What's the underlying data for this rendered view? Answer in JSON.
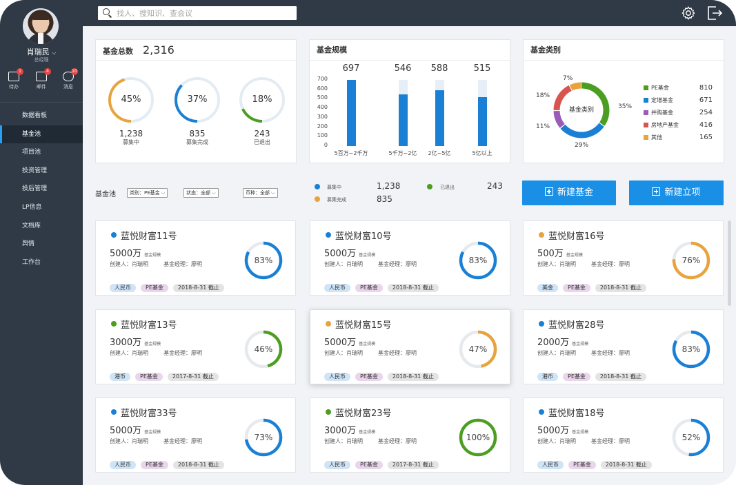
{
  "user": {
    "name": "肖瑞民",
    "role": "总经理"
  },
  "quick": [
    {
      "label": "待办",
      "badge": "1",
      "icon": "todo-icon"
    },
    {
      "label": "邮件",
      "badge": "4",
      "icon": "mail-icon"
    },
    {
      "label": "消息",
      "badge": "10",
      "icon": "message-icon"
    }
  ],
  "nav": [
    "数据看板",
    "基金池",
    "项目池",
    "投资管理",
    "投后管理",
    "LP信息",
    "文档库",
    "舆情",
    "工作台"
  ],
  "nav_active": "基金池",
  "search": {
    "placeholder": "找人、搜知识、查会议"
  },
  "summary": {
    "title": "基金总数",
    "total": "2,316",
    "rings": [
      {
        "pct": "45%",
        "value": "1,238",
        "label": "募集中",
        "color": "#e8a33d",
        "frac": 0.45
      },
      {
        "pct": "37%",
        "value": "835",
        "label": "募集完成",
        "color": "#1a80d6",
        "frac": 0.37
      },
      {
        "pct": "18%",
        "value": "243",
        "label": "已退出",
        "color": "#4c9e22",
        "frac": 0.18
      }
    ]
  },
  "scale": {
    "title": "基金规模",
    "chart_data": {
      "type": "bar",
      "categories": [
        "5百万~2千万",
        "5千万~2亿",
        "2亿~5亿",
        "5亿以上"
      ],
      "values": [
        697,
        546,
        588,
        515
      ],
      "ylim": [
        0,
        700
      ],
      "yticks": [
        "700",
        "600",
        "500",
        "400",
        "300",
        "200",
        "100",
        "0"
      ]
    }
  },
  "category": {
    "title": "基金类别",
    "center": "基金类别",
    "chart_data": {
      "type": "pie",
      "labels": [
        "PE基金",
        "定增基金",
        "并购基金",
        "房地产基金",
        "其他"
      ],
      "values": [
        810,
        671,
        254,
        416,
        165
      ],
      "percents": [
        "35%",
        "29%",
        "11%",
        "18%",
        "7%"
      ],
      "colors": [
        "#4c9e22",
        "#1a80d6",
        "#9b5bb8",
        "#d9534f",
        "#e8a33d"
      ]
    }
  },
  "filter": {
    "label": "基金池",
    "selects": [
      "类别：PE基金",
      "状态：全部",
      "币种：全部"
    ],
    "stats": [
      {
        "label": "募集中",
        "value": "1,238",
        "color": "#1a80d6"
      },
      {
        "label": "募集完成",
        "value": "835",
        "color": "#e8a33d"
      },
      {
        "label": "已退出",
        "value": "243",
        "color": "#4c9e22"
      }
    ],
    "new_fund": "新建基金",
    "new_project": "新建立项"
  },
  "card_labels": {
    "scale": "基金规模",
    "creator": "创建人：",
    "manager": "基金经理："
  },
  "cards": [
    {
      "name": "蓝悦财富11号",
      "amount": "5000万",
      "creator": "肖瑞明",
      "manager": "廖明",
      "pct": "83%",
      "frac": 0.83,
      "color": "#1a80d6",
      "currency": "人民币",
      "type": "PE基金",
      "date": "2018-8-31 截止"
    },
    {
      "name": "蓝悦财富10号",
      "amount": "5000万",
      "creator": "肖瑞明",
      "manager": "廖明",
      "pct": "83%",
      "frac": 0.83,
      "color": "#1a80d6",
      "currency": "人民币",
      "type": "PE基金",
      "date": "2018-8-31 截止"
    },
    {
      "name": "蓝悦财富16号",
      "amount": "500万",
      "creator": "肖瑞明",
      "manager": "廖明",
      "pct": "76%",
      "frac": 0.76,
      "color": "#e8a33d",
      "currency": "美金",
      "type": "PE基金",
      "date": "2018-8-31 截止"
    },
    {
      "name": "蓝悦财富13号",
      "amount": "3000万",
      "creator": "肖瑞明",
      "manager": "廖明",
      "pct": "46%",
      "frac": 0.46,
      "color": "#4c9e22",
      "currency": "港币",
      "type": "PE基金",
      "date": "2017-8-31 截止"
    },
    {
      "name": "蓝悦财富15号",
      "amount": "5000万",
      "creator": "肖瑞明",
      "manager": "廖明",
      "pct": "47%",
      "frac": 0.47,
      "color": "#e8a33d",
      "currency": "人民币",
      "type": "PE基金",
      "date": "2018-8-31 截止"
    },
    {
      "name": "蓝悦财富28号",
      "amount": "2000万",
      "creator": "肖瑞明",
      "manager": "廖明",
      "pct": "83%",
      "frac": 0.83,
      "color": "#1a80d6",
      "currency": "港币",
      "type": "PE基金",
      "date": "2018-8-31 截止"
    },
    {
      "name": "蓝悦财富33号",
      "amount": "5000万",
      "creator": "肖瑞明",
      "manager": "廖明",
      "pct": "73%",
      "frac": 0.73,
      "color": "#1a80d6",
      "currency": "人民币",
      "type": "PE基金",
      "date": "2018-8-31 截止"
    },
    {
      "name": "蓝悦财富23号",
      "amount": "3000万",
      "creator": "肖瑞明",
      "manager": "廖明",
      "pct": "100%",
      "frac": 1.0,
      "color": "#4c9e22",
      "currency": "人民币",
      "type": "PE基金",
      "date": "2017-8-31 截止"
    },
    {
      "name": "蓝悦财富18号",
      "amount": "5000万",
      "creator": "肖瑞明",
      "manager": "廖明",
      "pct": "52%",
      "frac": 0.52,
      "color": "#1a80d6",
      "currency": "人民币",
      "type": "PE基金",
      "date": "2018-8-31 截止"
    }
  ]
}
